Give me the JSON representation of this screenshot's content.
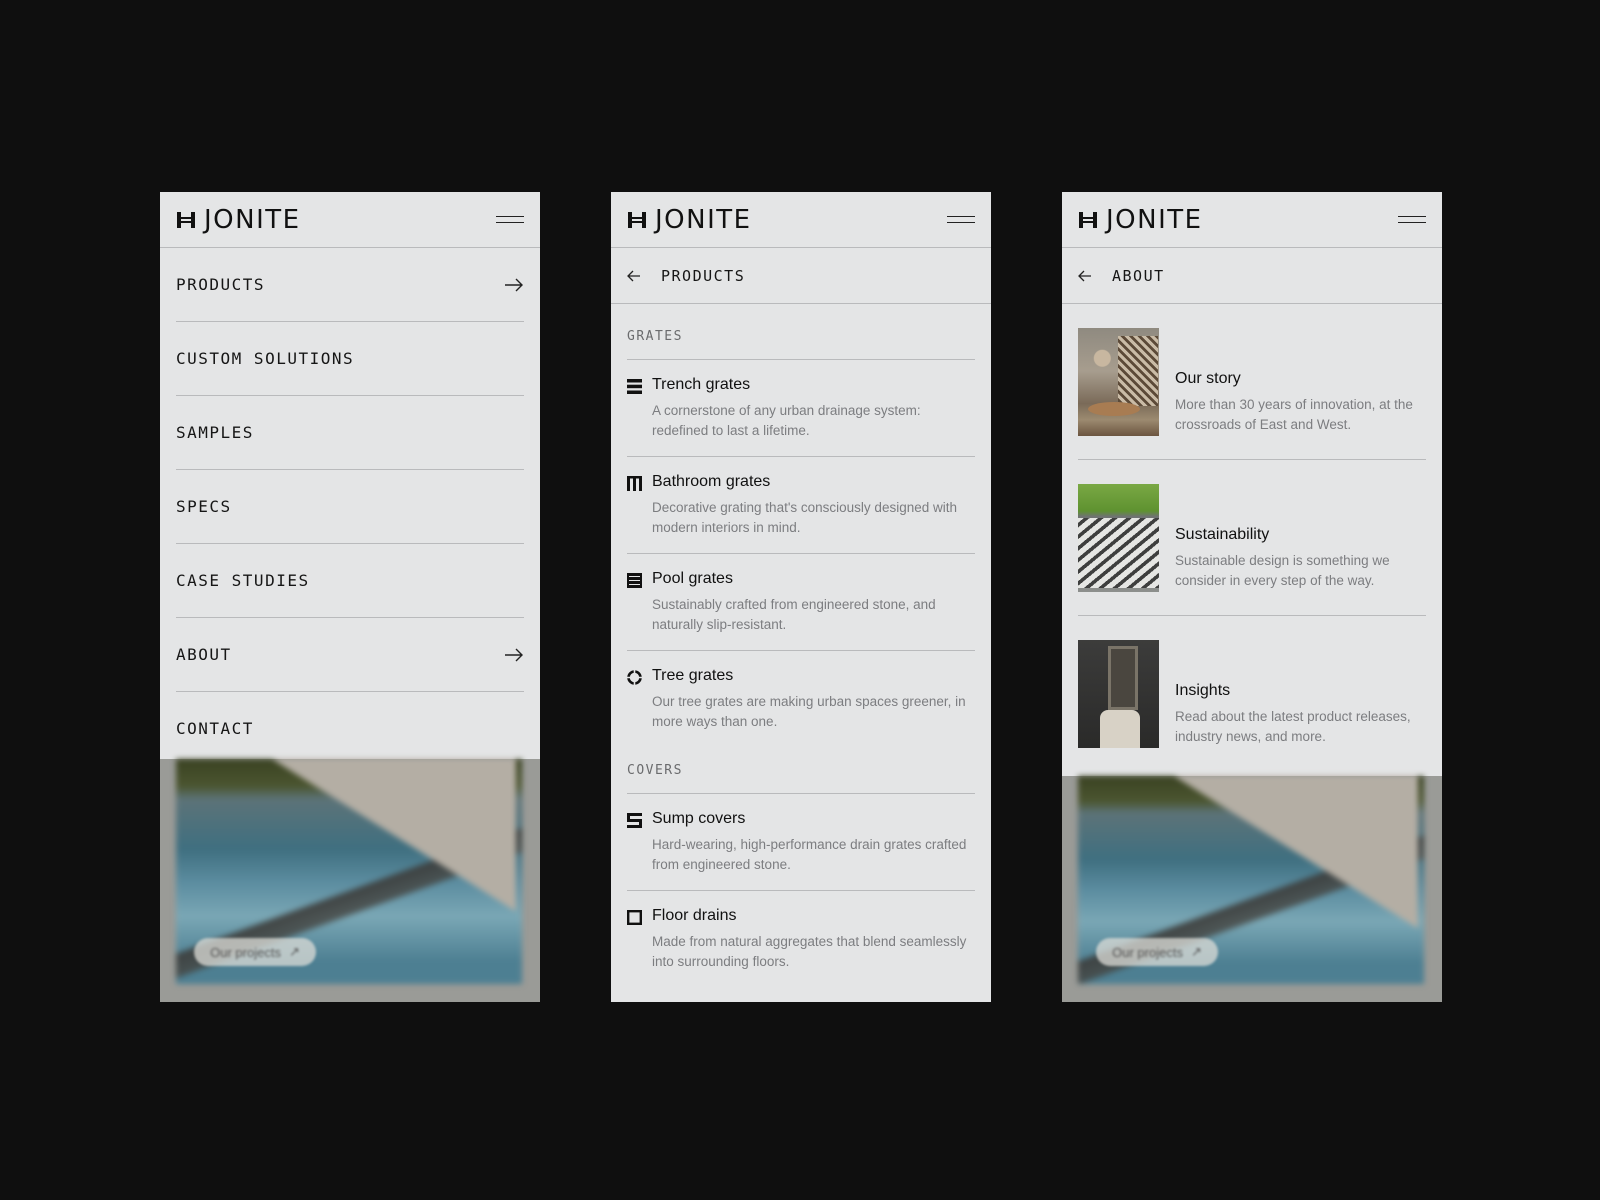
{
  "brand": {
    "name": "JONITE"
  },
  "menu": {
    "items": [
      {
        "label": "PRODUCTS",
        "has_arrow": true
      },
      {
        "label": "CUSTOM SOLUTIONS",
        "has_arrow": false
      },
      {
        "label": "SAMPLES",
        "has_arrow": false
      },
      {
        "label": "SPECS",
        "has_arrow": false
      },
      {
        "label": "CASE STUDIES",
        "has_arrow": false
      },
      {
        "label": "ABOUT",
        "has_arrow": true
      },
      {
        "label": "CONTACT",
        "has_arrow": false
      }
    ],
    "hero_button": "Our projects"
  },
  "products": {
    "header": "PRODUCTS",
    "groups": [
      {
        "label": "GRATES",
        "items": [
          {
            "title": "Trench grates",
            "desc": "A cornerstone of any urban drainage system: redefined to last a lifetime.",
            "icon": "trench-grate-icon"
          },
          {
            "title": "Bathroom grates",
            "desc": "Decorative grating that's consciously designed with modern interiors in mind.",
            "icon": "bathroom-grate-icon"
          },
          {
            "title": "Pool grates",
            "desc": "Sustainably crafted from engineered stone, and naturally slip-resistant.",
            "icon": "pool-grate-icon"
          },
          {
            "title": "Tree grates",
            "desc": "Our tree grates are making urban spaces greener, in more ways than one.",
            "icon": "tree-grate-icon"
          }
        ]
      },
      {
        "label": "COVERS",
        "items": [
          {
            "title": "Sump covers",
            "desc": "Hard-wearing, high-performance drain grates crafted from engineered stone.",
            "icon": "sump-cover-icon"
          },
          {
            "title": "Floor drains",
            "desc": "Made from natural aggregates that blend seamlessly into surrounding floors.",
            "icon": "floor-drain-icon"
          }
        ]
      }
    ]
  },
  "about": {
    "header": "ABOUT",
    "items": [
      {
        "title": "Our story",
        "desc": "More than 30 years of innovation, at the crossroads of East and West."
      },
      {
        "title": "Sustainability",
        "desc": "Sustainable design is something we consider in every step of the way."
      },
      {
        "title": "Insights",
        "desc": "Read about the latest product releases, industry news, and more."
      }
    ],
    "hero_button": "Our projects"
  }
}
